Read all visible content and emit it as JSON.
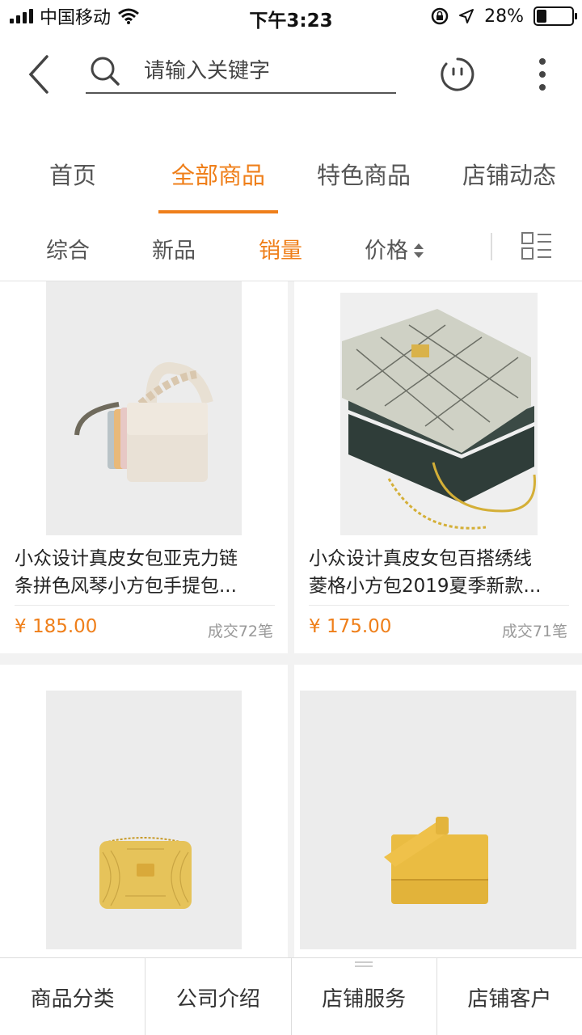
{
  "status_bar": {
    "carrier": "中国移动",
    "time": "下午3:23",
    "battery_text": "28%",
    "battery_level": 0.28
  },
  "search": {
    "placeholder": "请输入关键字"
  },
  "tabs": [
    {
      "label": "首页",
      "active": false
    },
    {
      "label": "全部商品",
      "active": true
    },
    {
      "label": "特色商品",
      "active": false
    },
    {
      "label": "店铺动态",
      "active": false
    }
  ],
  "filters": [
    {
      "label": "综合",
      "active": false
    },
    {
      "label": "新品",
      "active": false
    },
    {
      "label": "销量",
      "active": true
    },
    {
      "label": "价格",
      "active": false
    }
  ],
  "products": [
    {
      "title_line1": " 小众设计真皮女包亚克力链",
      "title_line2": "条拼色风琴小方包手提包...",
      "price": "¥ 185.00",
      "sold": "成交72笔",
      "image": "cream-handbag-with-chain"
    },
    {
      "title_line1": "小众设计真皮女包百搭绣线",
      "title_line2": "菱格小方包2019夏季新款...",
      "price": "¥ 175.00",
      "sold": "成交71笔",
      "image": "grey-quilted-bag"
    },
    {
      "title_line1": "",
      "title_line2": "",
      "price": "",
      "sold": "",
      "image": "yellow-quilted-bag"
    },
    {
      "title_line1": "",
      "title_line2": "",
      "price": "",
      "sold": "",
      "image": "yellow-flap-bag"
    }
  ],
  "bottom_bar": [
    {
      "label": "商品分类"
    },
    {
      "label": "公司介绍"
    },
    {
      "label": "店铺服务"
    },
    {
      "label": "店铺客户"
    }
  ],
  "colors": {
    "accent": "#ef7f1a",
    "text": "#333333",
    "muted": "#999999"
  }
}
